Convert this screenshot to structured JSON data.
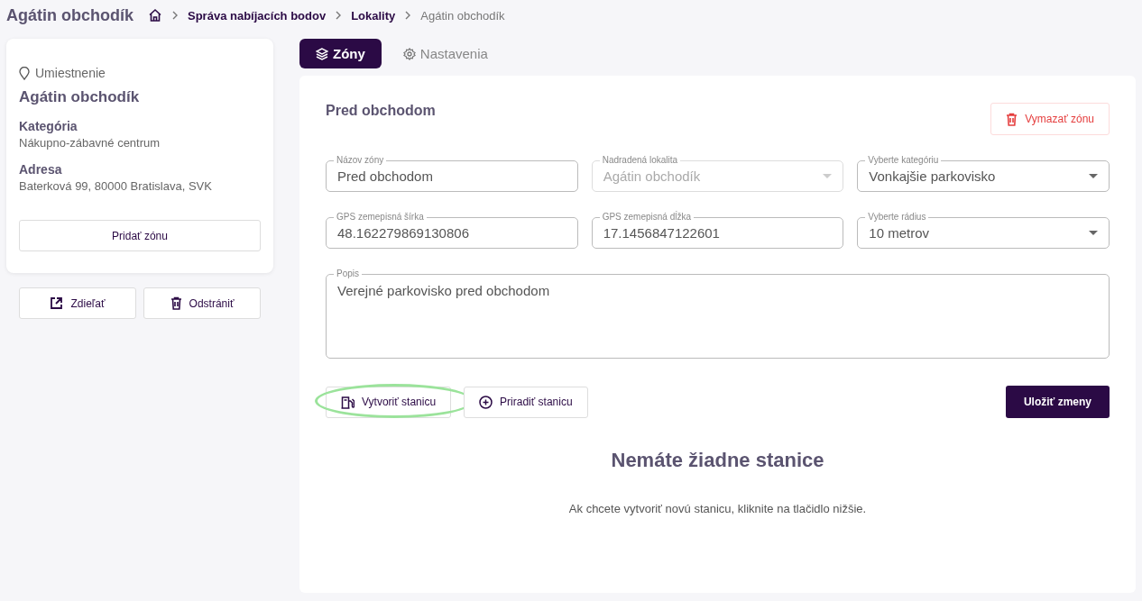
{
  "header": {
    "title": "Agátin obchodík",
    "breadcrumb": [
      {
        "label": "Správa nabíjacích bodov",
        "current": false
      },
      {
        "label": "Lokality",
        "current": false
      },
      {
        "label": "Agátin obchodík",
        "current": true
      }
    ]
  },
  "sidebar": {
    "location_label": "Umiestnenie",
    "name": "Agátin obchodík",
    "sections": [
      {
        "heading": "Kategória",
        "value": "Nákupno-zábavné centrum"
      },
      {
        "heading": "Adresa",
        "value": "Baterková 99, 80000 Bratislava, SVK"
      }
    ],
    "add_button": "Pridať zónu",
    "actions": [
      {
        "kind": "share",
        "label": "Zdieľať"
      },
      {
        "kind": "delete",
        "label": "Odstrániť"
      }
    ]
  },
  "tabs": [
    {
      "kind": "layers",
      "label": "Zóny",
      "selected": true
    },
    {
      "kind": "gear",
      "label": "Nastavenia",
      "selected": false
    }
  ],
  "zone": {
    "title": "Pred obchodom",
    "delete_button": "Vymazať zónu",
    "fields": [
      {
        "kind": "text",
        "label": "Názov zóny",
        "value": "Pred obchodom",
        "disabled": false
      },
      {
        "kind": "select",
        "label": "Nadradená lokalita",
        "value": "Agátin obchodík",
        "disabled": true
      },
      {
        "kind": "select",
        "label": "Vyberte kategóriu",
        "value": "Vonkajšie parkovisko",
        "disabled": false
      },
      {
        "kind": "text",
        "label": "GPS zemepisná šírka",
        "value": "48.162279869130806",
        "disabled": false
      },
      {
        "kind": "text",
        "label": "GPS zemepisná dĺžka",
        "value": "17.1456847122601",
        "disabled": false
      },
      {
        "kind": "select",
        "label": "Vyberte rádius",
        "value": "10 metrov",
        "disabled": false
      }
    ],
    "description": {
      "label": "Popis",
      "value": "Verejné parkovisko pred obchodom"
    },
    "station_buttons": [
      {
        "kind": "pump",
        "label": "Vytvoriť stanicu",
        "highlighted": true
      },
      {
        "kind": "plus",
        "label": "Priradiť stanicu",
        "highlighted": false
      }
    ],
    "save_button": "Uložiť zmeny",
    "empty_title": "Nemáte žiadne stanice",
    "empty_text": "Ak chcete vytvoriť novú stanicu, kliknite na tlačidlo nižšie."
  }
}
